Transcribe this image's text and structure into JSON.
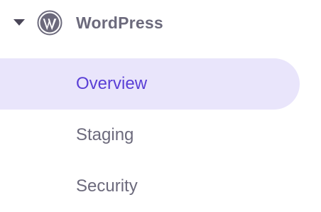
{
  "group": {
    "title": "WordPress",
    "expanded": true,
    "icon": "wordpress-logo-icon",
    "caret_icon": "caret-down-icon"
  },
  "items": [
    {
      "label": "Overview",
      "active": true
    },
    {
      "label": "Staging",
      "active": false
    },
    {
      "label": "Security",
      "active": false
    }
  ],
  "colors": {
    "active_bg": "#e9e5fb",
    "active_text": "#5a3fd6",
    "text": "#6c6a7c",
    "caret": "#4a4658"
  }
}
